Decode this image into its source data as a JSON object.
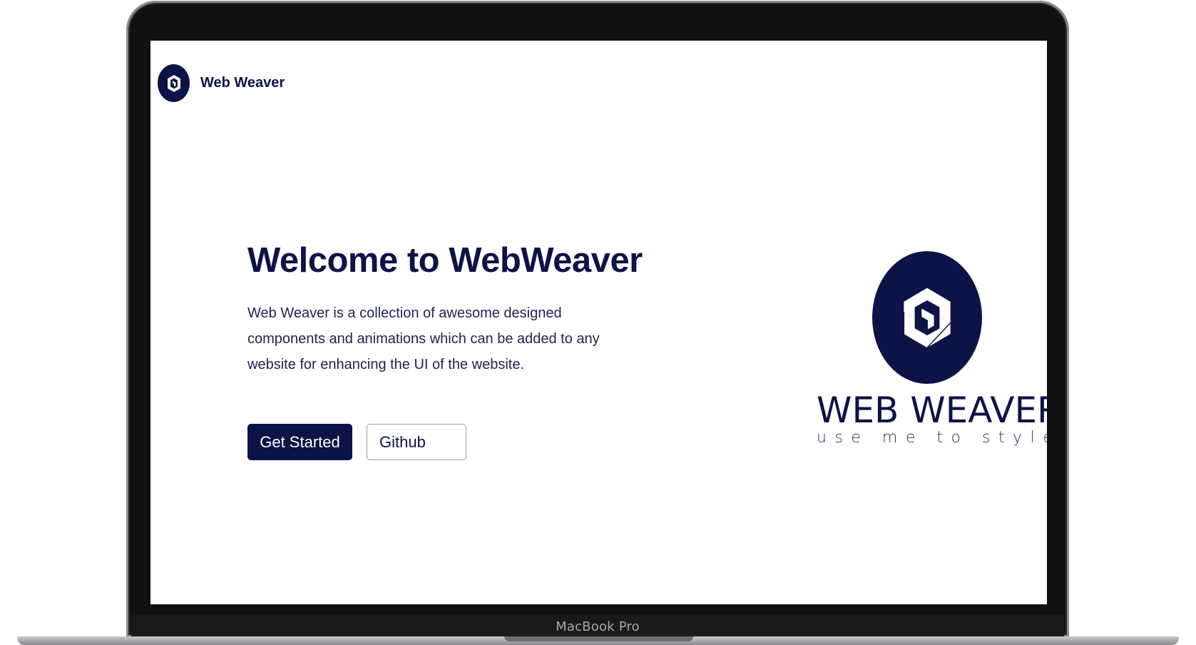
{
  "device": {
    "label": "MacBook Pro"
  },
  "nav": {
    "logo_icon": "web-weaver-logo-icon",
    "title": "Web Weaver"
  },
  "hero": {
    "title": "Welcome to WebWeaver",
    "description": "Web Weaver is a collection of awesome designed components and animations which can be added to any website for enhancing the UI of the website.",
    "primary_button": "Get Started",
    "secondary_button": "Github"
  },
  "brand": {
    "logo_icon": "web-weaver-logo-icon",
    "name": "WEB WEAVER",
    "tagline": "use me to style"
  },
  "colors": {
    "brand_navy": "#0c1347",
    "background": "#ffffff",
    "button_border": "#9a9cae"
  }
}
